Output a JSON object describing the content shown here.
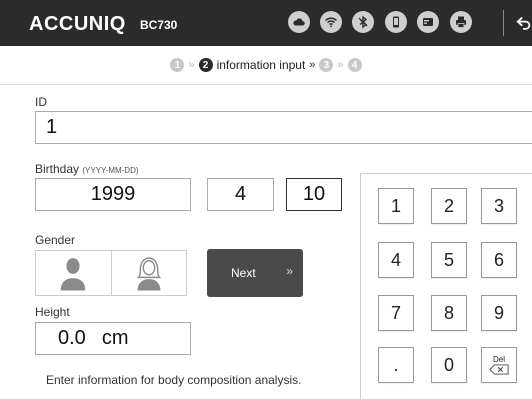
{
  "header": {
    "brand": "ACCUNIQ",
    "model": "BC730",
    "status_icons": [
      "cloud-icon",
      "wifi-icon",
      "bluetooth-icon",
      "phone-icon",
      "card-icon",
      "printer-icon"
    ],
    "back_icon": "back-arrow-icon"
  },
  "steps": {
    "items": [
      {
        "number": "1",
        "active": false
      },
      {
        "number": "2",
        "active": true,
        "label": "information input"
      },
      {
        "number": "3",
        "active": false
      },
      {
        "number": "4",
        "active": false
      }
    ]
  },
  "form": {
    "id_label": "ID",
    "id_value": "1",
    "birthday_label": "Birthday",
    "birthday_format": "(YYYY-MM-DD)",
    "year": "1999",
    "month": "4",
    "day": "10",
    "gender_label": "Gender",
    "gender_options": [
      "male-icon",
      "female-icon"
    ],
    "next_label": "Next",
    "height_label": "Height",
    "height_value": "0.0",
    "height_unit": "cm",
    "footnote": "Enter information for body composition analysis."
  },
  "keypad": {
    "keys": [
      "1",
      "2",
      "3",
      "4",
      "5",
      "6",
      "7",
      "8",
      "9",
      ".",
      "0",
      "Del"
    ]
  },
  "colors": {
    "header_bg": "#2b2b2b",
    "next_bg": "#4a4a4a"
  }
}
